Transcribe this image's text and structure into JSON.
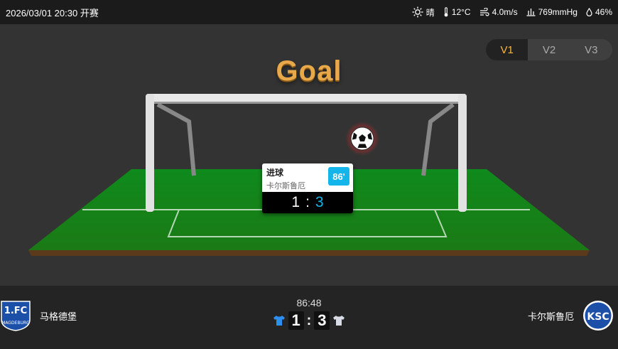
{
  "topbar": {
    "datetime": "2026/03/01 20:30 开赛",
    "weather": {
      "condition": "晴",
      "temperature": "12°C",
      "wind": "4.0m/s",
      "pressure": "769mmHg",
      "humidity": "46%"
    }
  },
  "view_tabs": {
    "tabs": [
      "V1",
      "V2",
      "V3"
    ],
    "active": "V1"
  },
  "animation": {
    "headline": "Goal",
    "event_card": {
      "event": "进球",
      "team": "卡尔斯鲁厄",
      "minute": "86'",
      "home_score": "1",
      "separator": ":",
      "away_score": "3"
    }
  },
  "scoreboard": {
    "home_team": "马格德堡",
    "away_team": "卡尔斯鲁厄",
    "clock": "86:48",
    "home_score": "1",
    "separator": ":",
    "away_score": "3",
    "home_shirt_color": "#2f8ff0",
    "away_shirt_color": "#d8dce6"
  },
  "colors": {
    "accent": "#f5b83d",
    "highlight": "#13b5ea",
    "pitch": "#1a8a1a"
  }
}
